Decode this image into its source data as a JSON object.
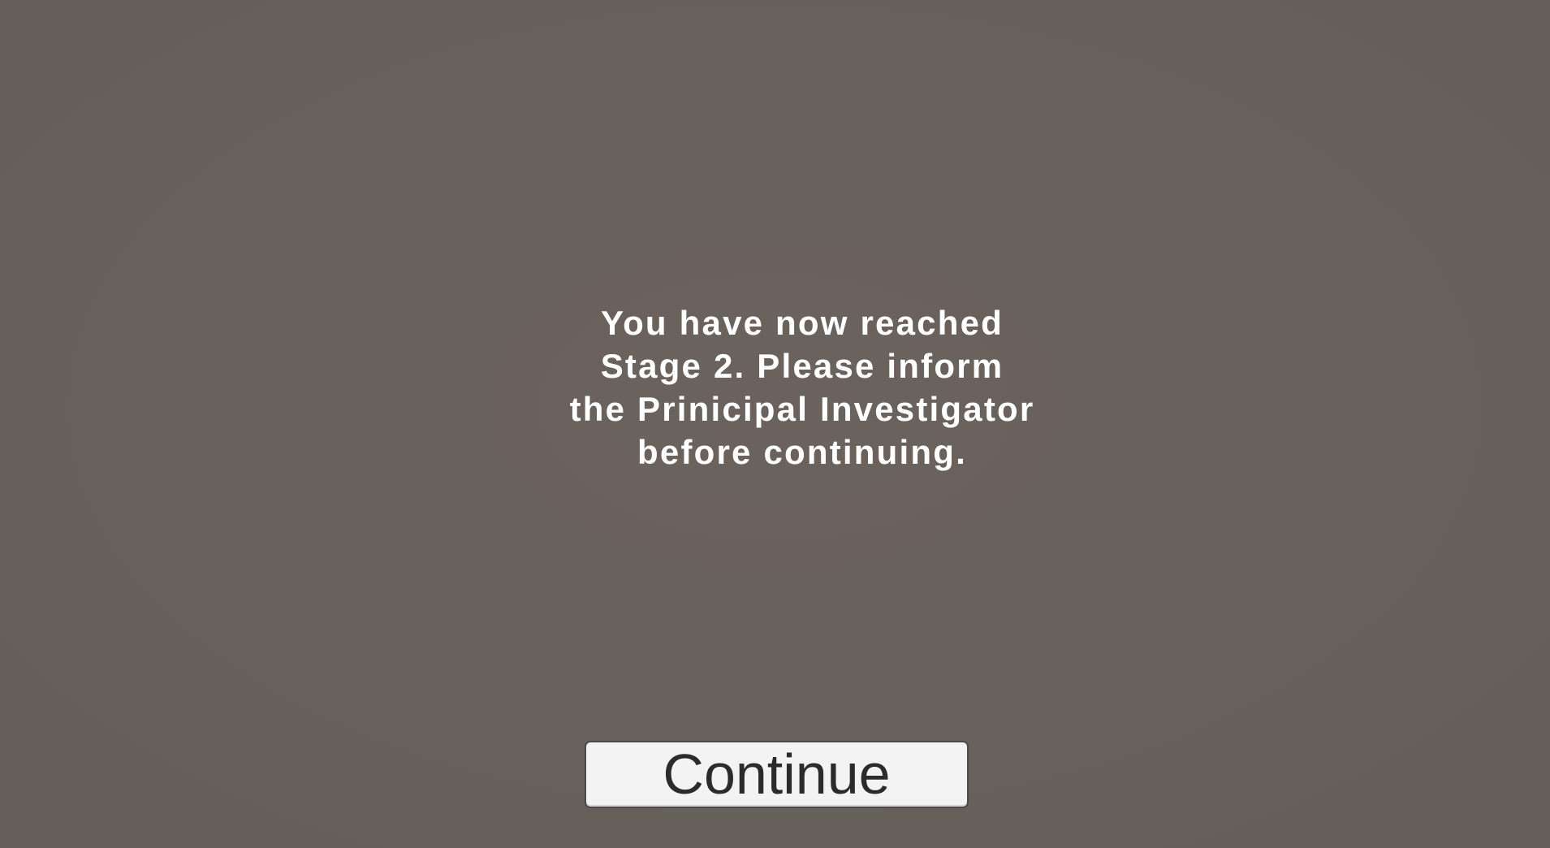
{
  "screen": {
    "message": "You have now reached Stage 2. Please inform the Prinicipal Investigator before continuing.",
    "continue_label": "Continue"
  },
  "colors": {
    "background": "#67605b",
    "message_text": "#ffffff",
    "button_background": "#f3f3f3",
    "button_text": "#2b2b2b"
  }
}
